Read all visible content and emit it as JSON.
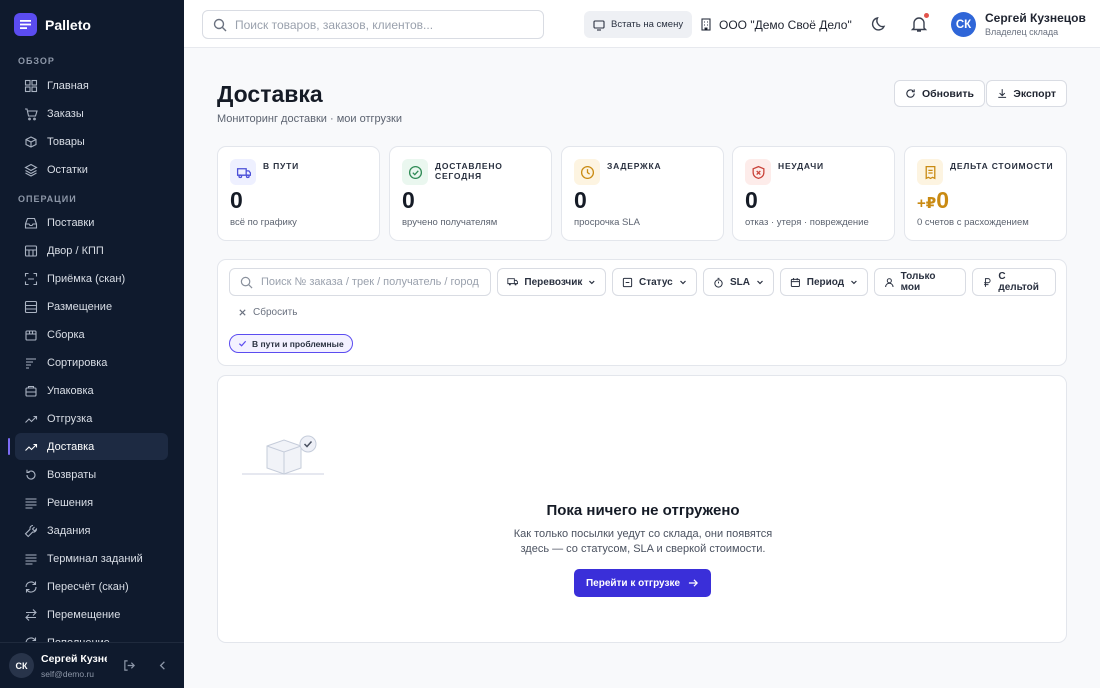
{
  "app": {
    "name": "Palleto"
  },
  "sidebar": {
    "section_overview": "ОБЗОР",
    "section_operations": "ОПЕРАЦИИ",
    "overview_items": [
      {
        "label": "Главная",
        "icon": "grid-icon"
      },
      {
        "label": "Заказы",
        "icon": "cart-icon"
      },
      {
        "label": "Товары",
        "icon": "box-icon"
      },
      {
        "label": "Остатки",
        "icon": "layers-icon"
      }
    ],
    "operation_items": [
      {
        "label": "Поставки",
        "icon": "inbox-icon"
      },
      {
        "label": "Двор / КПП",
        "icon": "gate-icon"
      },
      {
        "label": "Приёмка (скан)",
        "icon": "scan-icon"
      },
      {
        "label": "Размещение",
        "icon": "shelf-icon"
      },
      {
        "label": "Сборка",
        "icon": "package-icon"
      },
      {
        "label": "Сортировка",
        "icon": "sort-icon"
      },
      {
        "label": "Упаковка",
        "icon": "pack-icon"
      },
      {
        "label": "Отгрузка",
        "icon": "trend-icon"
      },
      {
        "label": "Доставка",
        "icon": "trend-icon"
      },
      {
        "label": "Возвраты",
        "icon": "return-icon"
      },
      {
        "label": "Решения",
        "icon": "list-icon"
      },
      {
        "label": "Задания",
        "icon": "tool-icon"
      },
      {
        "label": "Терминал заданий",
        "icon": "list-icon"
      },
      {
        "label": "Пересчёт (скан)",
        "icon": "refresh-icon"
      },
      {
        "label": "Перемещение",
        "icon": "swap-icon"
      },
      {
        "label": "Пополнение",
        "icon": "refresh-icon"
      }
    ],
    "active_item": "Доставка",
    "footer": {
      "initials": "СК",
      "name": "Сергей Кузнецов",
      "email": "self@demo.ru"
    }
  },
  "topbar": {
    "search_placeholder": "Поиск товаров, заказов, клиентов...",
    "shift_button": "Встать на смену",
    "org_name": "ООО \"Демо Своё Дело\"",
    "user": {
      "initials": "СК",
      "name": "Сергей Кузнецов",
      "role": "Владелец склада"
    }
  },
  "page": {
    "title": "Доставка",
    "subtitle": "Мониторинг доставки · мои отгрузки",
    "refresh_button": "Обновить",
    "export_button": "Экспорт"
  },
  "stats": [
    {
      "label": "В ПУТИ",
      "value": "0",
      "note": "всё по графику",
      "icon": "truck-icon",
      "bg": "#eef0ff",
      "color": "#4b4fd8"
    },
    {
      "label": "ДОСТАВЛЕНО СЕГОДНЯ",
      "value": "0",
      "note": "вручено получателям",
      "icon": "check-circle-icon",
      "bg": "#eaf7ef",
      "color": "#2f8a55"
    },
    {
      "label": "ЗАДЕРЖКА",
      "value": "0",
      "note": "просрочка SLA",
      "icon": "clock-icon",
      "bg": "#fdf4e1",
      "color": "#c98a12"
    },
    {
      "label": "НЕУДАЧИ",
      "value": "0",
      "note": "отказ · утеря · повреждение",
      "icon": "shield-x-icon",
      "bg": "#fdecea",
      "color": "#c9433a"
    },
    {
      "label": "ДЕЛЬТА СТОИМОСТИ",
      "value": "0",
      "value_prefix": "+₽",
      "note": "0 счетов с расхождением",
      "icon": "receipt-icon",
      "bg": "#fdf4e1",
      "color": "#c98a12"
    }
  ],
  "filters": {
    "search_placeholder": "Поиск № заказа / трек / получатель / город",
    "carrier": "Перевозчик",
    "status": "Статус",
    "sla": "SLA",
    "period": "Период",
    "only_mine": "Только мои",
    "with_delta": "С дельтой",
    "reset": "Сбросить",
    "active_chip": "В пути и проблемные"
  },
  "empty_state": {
    "title": "Пока ничего не отгружено",
    "text": "Как только посылки уедут со склада, они появятся здесь — со статусом, SLA и сверкой стоимости.",
    "button": "Перейти к отгрузке"
  }
}
